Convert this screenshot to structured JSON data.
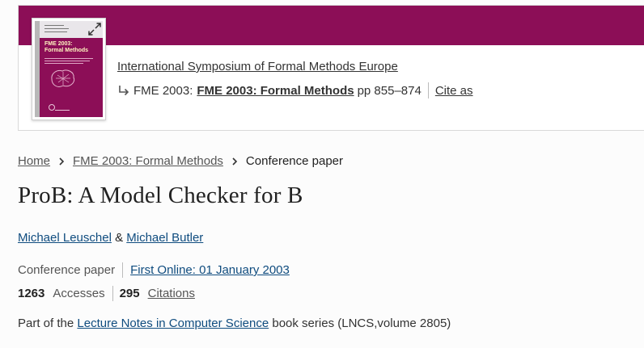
{
  "colors": {
    "brand": "#8c0e57",
    "link": "#0f4c7f"
  },
  "book": {
    "cover_alt": "FME 2003: Formal Methods",
    "cover_title_line1": "FME 2003:",
    "cover_title_line2": "Formal Methods",
    "series_link": "International Symposium of Formal Methods Europe",
    "conference_prefix": "FME 2003:",
    "book_title": "FME 2003: Formal Methods",
    "pages": "pp 855–874",
    "cite_as": "Cite as",
    "expand_icon": "expand-icon",
    "arrow_icon": "subdirectory-arrow-icon"
  },
  "breadcrumb": {
    "items": [
      "Home",
      "FME 2003: Formal Methods"
    ],
    "current": "Conference paper",
    "separator_icon": "chevron-right-icon"
  },
  "paper": {
    "title": "ProB: A Model Checker for B",
    "authors": [
      "Michael Leuschel",
      "Michael Butler"
    ],
    "author_separator": "&",
    "type": "Conference paper",
    "first_online": "First Online: 01 January 2003",
    "accesses_count": "1263",
    "accesses_label": "Accesses",
    "citations_count": "295",
    "citations_label": "Citations"
  },
  "series": {
    "prefix": "Part of the",
    "name": "Lecture Notes in Computer Science",
    "suffix": "book series (LNCS,volume 2805)"
  }
}
